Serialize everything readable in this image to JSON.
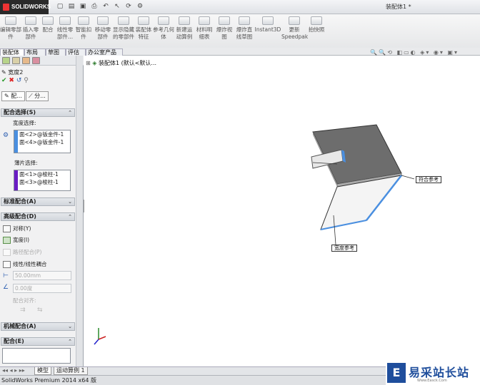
{
  "app": {
    "logo_text": "SOLIDWORKS",
    "window_title": "装配体1 *"
  },
  "ribbon": {
    "buttons": [
      "编辑零部件",
      "插入零部件",
      "配合",
      "线性零部件...",
      "智能扣件",
      "移动零部件",
      "显示隐藏的零部件",
      "装配体特征",
      "参考几何体",
      "新建运动算例",
      "材料明细表",
      "爆炸视图",
      "爆炸直线草图",
      "Instant3D",
      "更新Speedpak",
      "拍快照"
    ]
  },
  "tabs": {
    "items": [
      "装配体",
      "布局",
      "草图",
      "评估",
      "办公室产品"
    ],
    "active": 0
  },
  "tree": {
    "root": "装配体1 (默认<默认..."
  },
  "feature": {
    "title": "宽度2",
    "subtabs": [
      "配...",
      "分..."
    ],
    "sections": {
      "mate_selection": {
        "title": "配合选择(S)",
        "width_label": "宽度选择:",
        "width_items": [
          "面<2>@钣金件-1",
          "面<4>@钣金件-1"
        ],
        "tab_label": "薄片选择:",
        "tab_items": [
          "面<1>@梭柱-1",
          "面<3>@梭柱-1"
        ]
      },
      "standard": {
        "title": "标准配合(A)"
      },
      "advanced": {
        "title": "高级配合(D)",
        "options": [
          "对称(Y)",
          "宽度(I)",
          "路径配合(P)",
          "线性/线性耦合"
        ],
        "distance_value": "50.00mm",
        "angle_value": "0.00度",
        "mate_align_label": "配合对齐:"
      },
      "mechanical": {
        "title": "机械配合(A)"
      },
      "mates": {
        "title": "配合(E)"
      }
    }
  },
  "view": {
    "callouts": [
      "符合参考",
      "宽度参考"
    ]
  },
  "bottom_tabs": [
    "模型",
    "运动算例 1"
  ],
  "status": {
    "text": "SolidWorks Premium 2014 x64 版"
  },
  "watermark": {
    "brand": "易采站长站",
    "url": "Www.Easck.Com"
  },
  "colors": {
    "selection_blue": "#4a8fe0",
    "selection_purple": "#6a1cc4",
    "part_gray": "#6d6d6d"
  }
}
